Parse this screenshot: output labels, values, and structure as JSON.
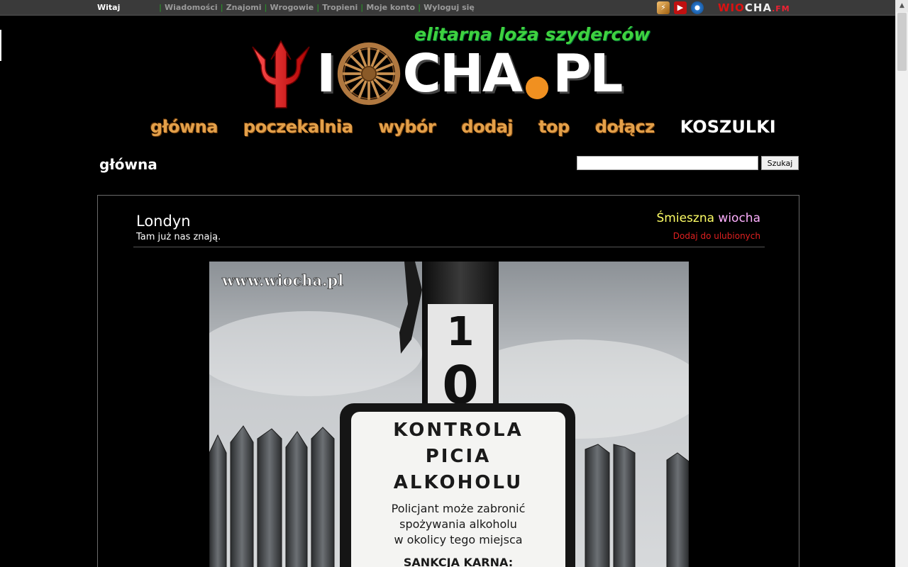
{
  "topbar": {
    "greeting": "Witaj",
    "nav": [
      "Wiadomości",
      "Znajomi",
      "Wrogowie",
      "Tropieni",
      "Moje konto",
      "Wyloguj się"
    ],
    "fm_logo": {
      "part1": "WIO",
      "part2": "CHA",
      "part3": ".FM"
    }
  },
  "logo": {
    "tagline": "elitarna loża szyderców",
    "name_part1": "I",
    "name_part2": "CHA",
    "name_part3": "PL"
  },
  "mainnav": [
    "główna",
    "poczekalnia",
    "wybór",
    "dodaj",
    "top",
    "dołącz",
    "KOSZULKI"
  ],
  "section_title": "główna",
  "search": {
    "value": "",
    "button_label": "Szukaj"
  },
  "post": {
    "title": "Londyn",
    "subtitle": "Tam już nas znają.",
    "category_part1": "Śmieszna",
    "category_part2": "wiocha",
    "fav_link": "Dodaj do ulubionych"
  },
  "photo": {
    "watermark": "www.wiocha.pl",
    "pole_number_top": "1",
    "pole_number_bottom": "0",
    "sign_line1": "KONTROLA",
    "sign_line2": "PICIA",
    "sign_line3": "ALKOHOLU",
    "sign_body1": "Policjant może zabronić",
    "sign_body2": "spożywania alkoholu",
    "sign_body3": "w okolicy tego miejsca",
    "sign_footer": "SANKCJA KARNA:"
  },
  "colors": {
    "nav_orange": "#e3a04a",
    "topnav_sep": "#2a8a2a",
    "tagline_green": "#3fd23f"
  }
}
